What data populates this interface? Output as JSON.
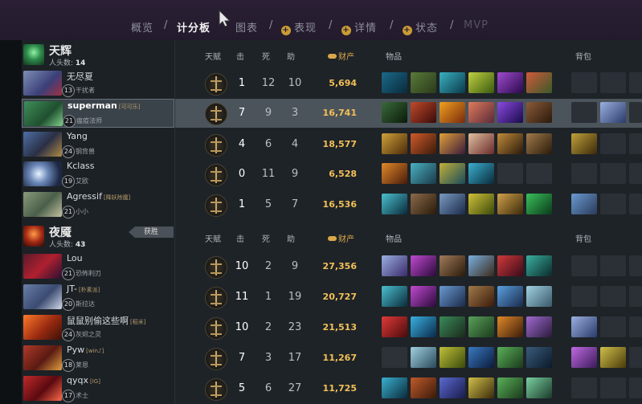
{
  "nav": {
    "items": [
      {
        "label": "概览",
        "icon": "",
        "state": "normal"
      },
      {
        "label": "计分板",
        "icon": "",
        "state": "active"
      },
      {
        "label": "图表",
        "icon": "",
        "state": "normal"
      },
      {
        "label": "表现",
        "icon": "+",
        "state": "normal"
      },
      {
        "label": "详情",
        "icon": "+",
        "state": "normal"
      },
      {
        "label": "状态",
        "icon": "+",
        "state": "normal"
      },
      {
        "label": "MVP",
        "icon": "",
        "state": "disabled"
      }
    ],
    "separator": "/"
  },
  "headers": {
    "talent": "天赋",
    "kills": "击",
    "deaths": "死",
    "assists": "助",
    "networth": "财产",
    "items": "物品",
    "backpack": "背包"
  },
  "teams": [
    {
      "name": "天辉",
      "kills_label": "人头数:",
      "kills": "14",
      "badge": "",
      "players": [
        {
          "name": "无尽夏",
          "tag": "",
          "level": "13",
          "hero": "干扰者",
          "k": "1",
          "d": "12",
          "a": "10",
          "networth": "5,694",
          "selected": false
        },
        {
          "name": "superman",
          "tag": "[可可乐]",
          "level": "21",
          "hero": "瘟疫法师",
          "k": "7",
          "d": "9",
          "a": "3",
          "networth": "16,741",
          "selected": true
        },
        {
          "name": "Yang",
          "tag": "",
          "level": "24",
          "hero": "钢背兽",
          "k": "4",
          "d": "6",
          "a": "4",
          "networth": "18,577",
          "selected": false
        },
        {
          "name": "Kclass",
          "tag": "",
          "level": "19",
          "hero": "艾欧",
          "k": "0",
          "d": "11",
          "a": "9",
          "networth": "6,528",
          "selected": false
        },
        {
          "name": "Agressif",
          "tag": "[降妖除魔]",
          "level": "21",
          "hero": "小小",
          "k": "1",
          "d": "5",
          "a": "7",
          "networth": "16,536",
          "selected": false
        }
      ]
    },
    {
      "name": "夜魇",
      "kills_label": "人头数:",
      "kills": "43",
      "badge": "获胜",
      "players": [
        {
          "name": "Lou",
          "tag": "",
          "level": "21",
          "hero": "恐怖利刃",
          "k": "10",
          "d": "2",
          "a": "9",
          "networth": "27,356",
          "selected": false
        },
        {
          "name": "JT-",
          "tag": "[朴素派]",
          "level": "20",
          "hero": "斯拉达",
          "k": "11",
          "d": "1",
          "a": "19",
          "networth": "20,727",
          "selected": false
        },
        {
          "name": "鼠鼠别偷这些啊",
          "tag": "[稻米]",
          "level": "24",
          "hero": "灰烬之灵",
          "k": "10",
          "d": "2",
          "a": "23",
          "networth": "21,513",
          "selected": false
        },
        {
          "name": "Pyw",
          "tag": "[win♪]",
          "level": "18",
          "hero": "莱恩",
          "k": "7",
          "d": "3",
          "a": "17",
          "networth": "11,267",
          "selected": false
        },
        {
          "name": "qyqx",
          "tag": "[IG]",
          "level": "17",
          "hero": "术士",
          "k": "5",
          "d": "6",
          "a": "27",
          "networth": "11,725",
          "selected": false
        }
      ]
    }
  ],
  "colors": {
    "accent_gold": "#f2c057",
    "radiant": "#3aa35b",
    "dire": "#b23a2a"
  }
}
